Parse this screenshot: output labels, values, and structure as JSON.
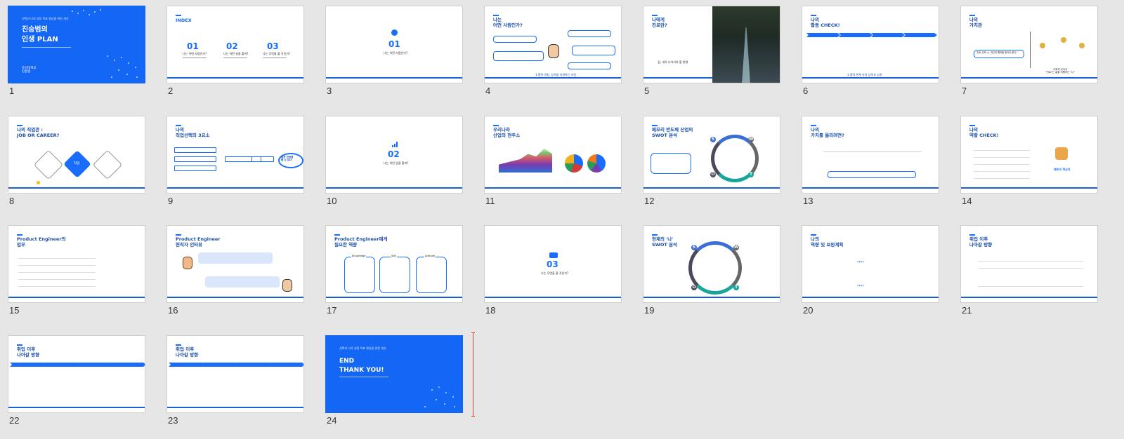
{
  "slides": [
    {
      "num": "1",
      "title": "진승범의\n인생 PLAN",
      "sub": "선택과 나의 성장 목표 향상을 위한 개선",
      "author": "조선대학교\n진승범"
    },
    {
      "num": "2",
      "header": "INDEX",
      "items": [
        {
          "n": "01",
          "label": "나는 어떤 사람인가?"
        },
        {
          "n": "02",
          "label": "나는 어떤 일을 할까?"
        },
        {
          "n": "03",
          "label": "나는 무엇을 할 것인가?"
        }
      ]
    },
    {
      "num": "3",
      "n": "01",
      "label": "나는 어떤 사람인가?"
    },
    {
      "num": "4",
      "header": "나는\n어떤 사람인가?",
      "footer": "1.협력 경험, 능력을 지향하는 사람"
    },
    {
      "num": "5",
      "header": "나에게\n진로란?",
      "footer": "길, 내가 나아가야 할 방향"
    },
    {
      "num": "6",
      "header": "나의\n활동 CHECK!",
      "footer": "1.협력 관계 유지 능력과 소통"
    },
    {
      "num": "7",
      "header": "나의\n가치관",
      "quote": "\"진로 선택 시, 개인의 행복을 찾아야 한다.\"",
      "footer": "나에게 있어서\n\"진로\"는 삶을 지탱하는 \"나\""
    },
    {
      "num": "8",
      "header": "나의 직업관 :\nJOB OR CAREER?",
      "center": "직업"
    },
    {
      "num": "9",
      "header": "나의\n직업선택의 3요소",
      "bubble": "일관 관점을\n볼 수 있다"
    },
    {
      "num": "10",
      "n": "02",
      "label": "나는 어떤 일을 할까?"
    },
    {
      "num": "11",
      "header": "우리나라\n산업의 현주소"
    },
    {
      "num": "12",
      "header": "메모리 반도체 산업의\nSWOT 분석"
    },
    {
      "num": "13",
      "header": "나의\n가치를 올리려면?"
    },
    {
      "num": "14",
      "header": "나의\n역할 CHECK!",
      "right": "제조의 혁신가"
    },
    {
      "num": "15",
      "header": "Product Engineer의\n업무"
    },
    {
      "num": "16",
      "header": "Product Engineer\n현직자 인터뷰"
    },
    {
      "num": "17",
      "header": "Product Engineer에게\n필요한 역량",
      "cols": [
        "Knowledge",
        "Skill",
        "Attitude"
      ]
    },
    {
      "num": "18",
      "n": "03",
      "label": "나는 무엇을 할 것인가?"
    },
    {
      "num": "19",
      "header": "현재의 '나'\nSWOT 분석"
    },
    {
      "num": "20",
      "header": "나의\n역량 및 보완계획"
    },
    {
      "num": "21",
      "header": "취업 이후\n나아갈 방향"
    },
    {
      "num": "22",
      "header": "취업 이후\n나아갈 방향"
    },
    {
      "num": "23",
      "header": "취업 이후\n나아갈 방향"
    },
    {
      "num": "24",
      "title": "END\nTHANK YOU!",
      "sub": "선택과 나의 성장 목표 향상을 위한 개선"
    }
  ],
  "swot": [
    "S",
    "W",
    "O",
    "T"
  ],
  "colors": {
    "accent": "#1a6dfb",
    "title_slide": "#1466f5"
  }
}
